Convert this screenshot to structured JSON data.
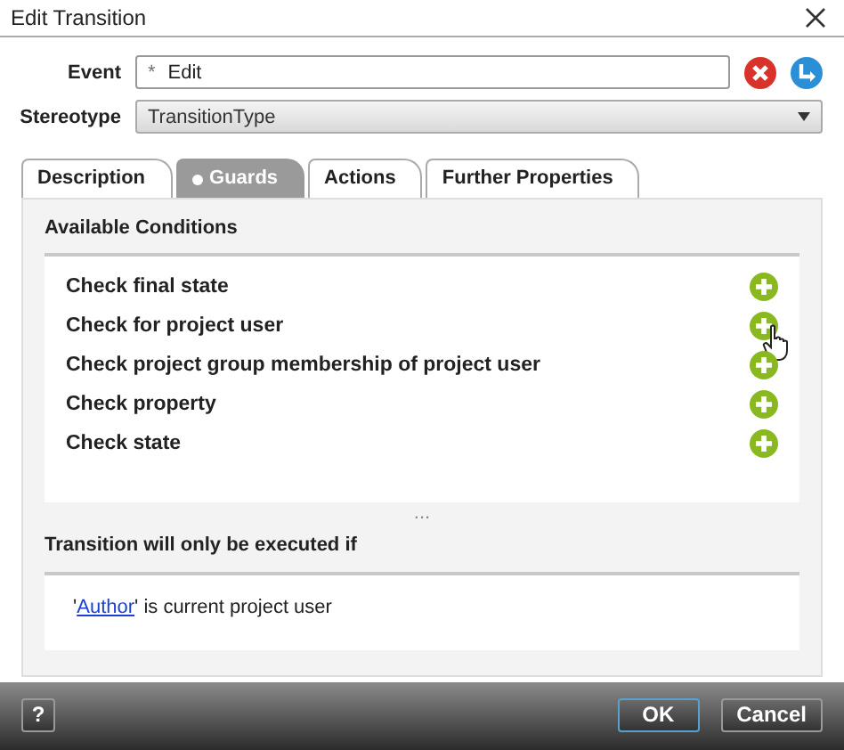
{
  "window": {
    "title": "Edit Transition"
  },
  "event": {
    "label": "Event",
    "marker": "*",
    "value": "Edit"
  },
  "stereotype": {
    "label": "Stereotype",
    "value": "TransitionType"
  },
  "tabs": [
    {
      "label": "Description",
      "selected": false
    },
    {
      "label": "Guards",
      "selected": true
    },
    {
      "label": "Actions",
      "selected": false
    },
    {
      "label": "Further Properties",
      "selected": false
    }
  ],
  "available_conditions": {
    "heading": "Available Conditions",
    "items": [
      {
        "label": "Check final state",
        "hovered": false
      },
      {
        "label": "Check for project user",
        "hovered": true
      },
      {
        "label": "Check project group membership of project user",
        "hovered": false
      },
      {
        "label": "Check property",
        "hovered": false
      },
      {
        "label": "Check state",
        "hovered": false
      }
    ]
  },
  "splitter": "...",
  "result": {
    "heading": "Transition will only be executed if",
    "prefix": "'",
    "link": "Author",
    "suffix": "' is current project user"
  },
  "footer": {
    "help": "?",
    "buttons": [
      {
        "label": "OK",
        "default": true
      },
      {
        "label": "Cancel",
        "default": false
      }
    ]
  }
}
